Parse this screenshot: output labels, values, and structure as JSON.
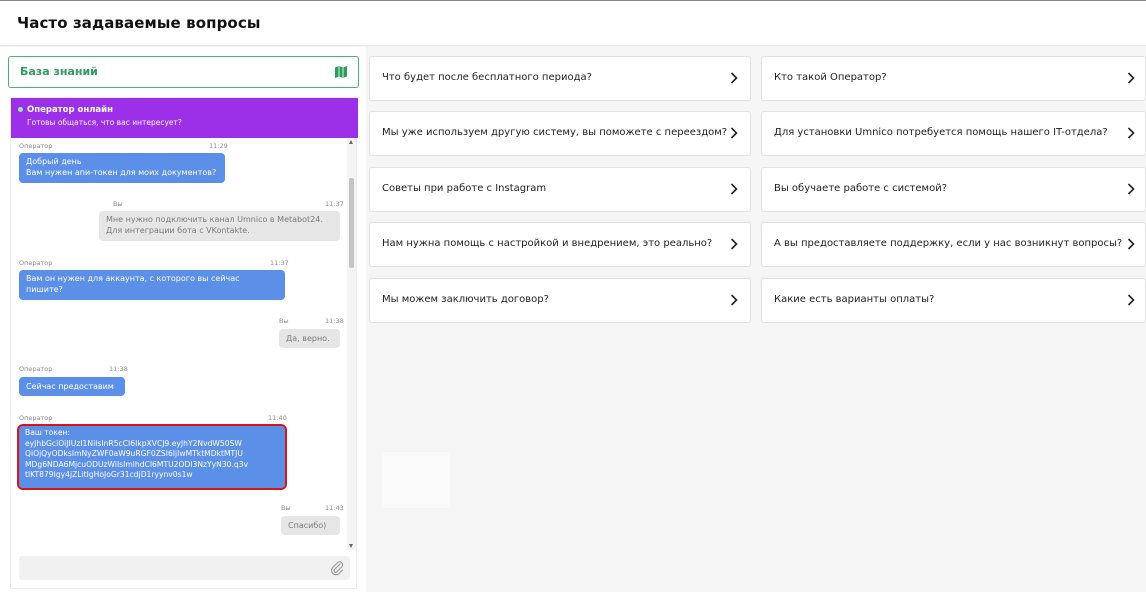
{
  "header": {
    "title": "Часто задаваемые вопросы"
  },
  "knowledge_base": {
    "label": "База знаний",
    "icon": "map-icon"
  },
  "chat": {
    "status_title": "Оператор онлайн",
    "status_subtitle": "Готовы общаться, что вас интересует?",
    "messages": [
      {
        "from": "Оператор",
        "time": "11:29",
        "text": "Добрый день\nВам нужен апи-токен для моих документов?"
      },
      {
        "from": "Вы",
        "time": "11:37",
        "text": "Мне нужно подключить канал Umnico в Metabot24.\nДля интеграции бота с VKontakte."
      },
      {
        "from": "Оператор",
        "time": "11:37",
        "text": "Вам он нужен для аккаунта, с которого вы сейчас\nпишите?"
      },
      {
        "from": "Вы",
        "time": "11:38",
        "text": "Да, верно."
      },
      {
        "from": "Оператор",
        "time": "11:38",
        "text": "Сейчас предоставим"
      },
      {
        "from": "Оператор",
        "time": "11:40",
        "text": "Ваш токен:\neyJhbGciOiJIUzI1NiIsInR5cCI6IkpXVCJ9.eyJhY2NvdW50SW\nQiOjQyODksImNyZWF0aW9uRGF0ZSI6IjIwMTktMDktMTJU\nMDg6NDA6MjcuODUzWiIsImlhdCI6MTU2ODI3NzYyN30.q3v\ntlKT879Igy4jZLitIgHoJoGr31cdjD1ryynv0s1w"
      },
      {
        "from": "Вы",
        "time": "11:43",
        "text": "Спасибо)"
      }
    ],
    "input_placeholder": "",
    "attach_icon": "paperclip-icon"
  },
  "faq": {
    "left": [
      "Что будет после бесплатного периода?",
      "Мы уже используем другую систему, вы поможете с переездом?",
      "Советы при работе с Instagram",
      "Нам нужна помощь с настройкой и внедрением, это реально?",
      "Мы можем заключить договор?"
    ],
    "right": [
      "Кто такой Оператор?",
      "Для установки Umnico потребуется помощь нашего IT-отдела?",
      "Вы обучаете работе с системой?",
      "А вы предоставляете поддержку, если у нас возникнут вопросы?",
      "Какие есть варианты оплаты?"
    ]
  },
  "colors": {
    "chat_header": "#9b30e8",
    "operator_bubble": "#5b8fe8",
    "user_bubble": "#e6e6e6",
    "knowledge_base_accent": "#2e9b5f",
    "highlight": "#d7141a"
  }
}
